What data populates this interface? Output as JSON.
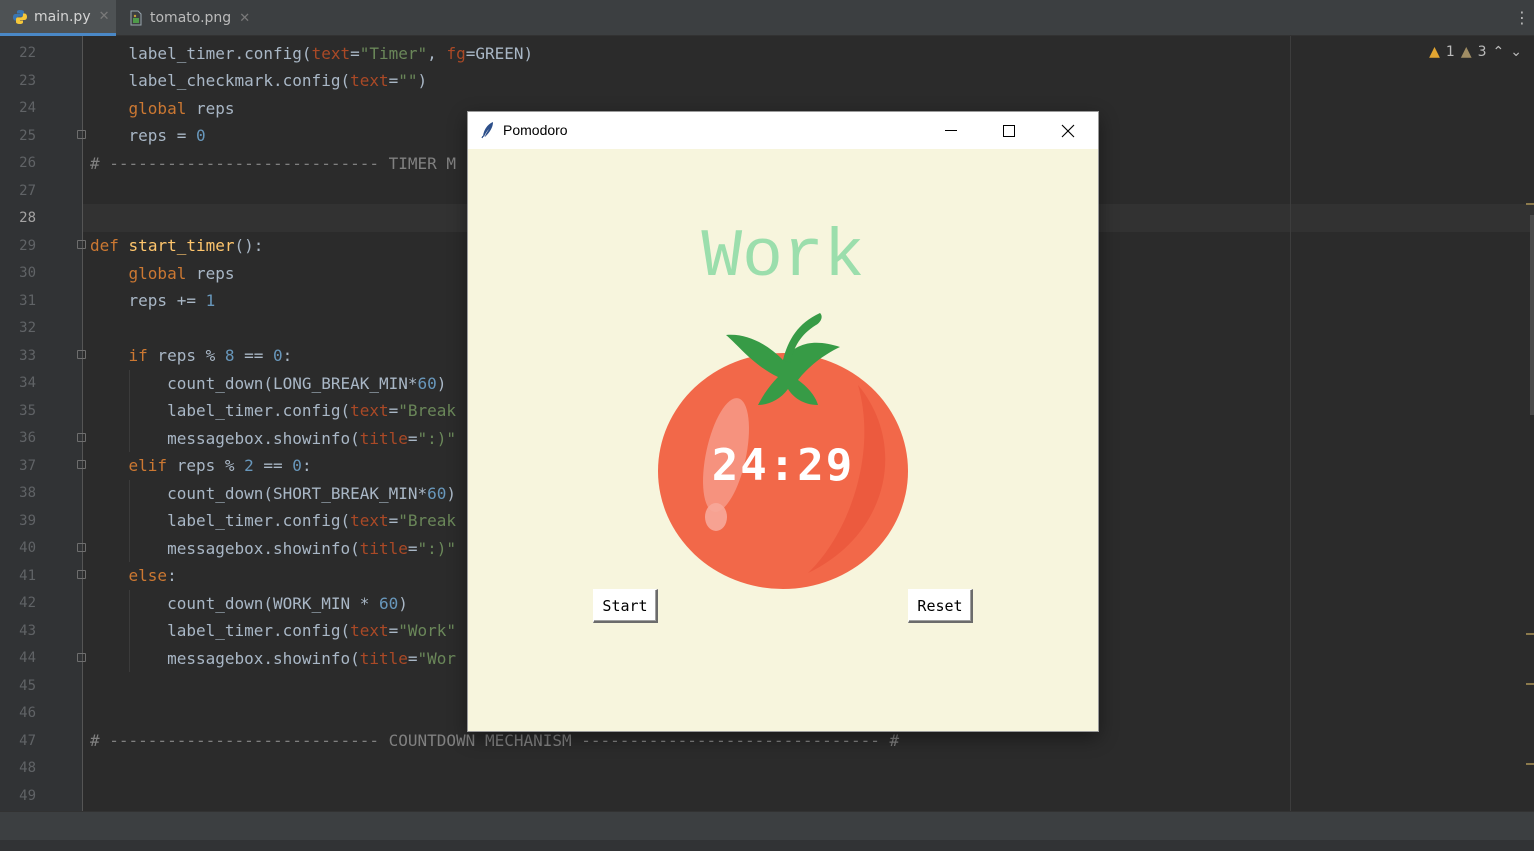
{
  "tabs": [
    {
      "label": "main.py",
      "active": true,
      "icon": "python-file-icon"
    },
    {
      "label": "tomato.png",
      "active": false,
      "icon": "image-file-icon"
    }
  ],
  "inspection": {
    "warnings": "1",
    "weak_warnings": "3"
  },
  "editor": {
    "current_line": "28",
    "lines": [
      {
        "n": "22"
      },
      {
        "n": "23"
      },
      {
        "n": "24"
      },
      {
        "n": "25"
      },
      {
        "n": "26"
      },
      {
        "n": "27"
      },
      {
        "n": "28"
      },
      {
        "n": "29"
      },
      {
        "n": "30"
      },
      {
        "n": "31"
      },
      {
        "n": "32"
      },
      {
        "n": "33"
      },
      {
        "n": "34"
      },
      {
        "n": "35"
      },
      {
        "n": "36"
      },
      {
        "n": "37"
      },
      {
        "n": "38"
      },
      {
        "n": "39"
      },
      {
        "n": "40"
      },
      {
        "n": "41"
      },
      {
        "n": "42"
      },
      {
        "n": "43"
      },
      {
        "n": "44"
      },
      {
        "n": "45"
      },
      {
        "n": "46"
      },
      {
        "n": "47"
      },
      {
        "n": "48"
      },
      {
        "n": "49"
      }
    ],
    "code": {
      "l22": "    label_timer.config(text=\"Timer\", fg=GREEN)",
      "l23": "    label_checkmark.config(text=\"\")",
      "l24": "    global reps",
      "l25": "    reps = 0",
      "l26": "# ---------------------------- TIMER M",
      "l29": "def start_timer():",
      "l30": "    global reps",
      "l31": "    reps += 1",
      "l33": "    if reps % 8 == 0:",
      "l34": "        count_down(LONG_BREAK_MIN*60)",
      "l35": "        label_timer.config(text=\"Break",
      "l36": "        messagebox.showinfo(title=\":)\"",
      "l37": "    elif reps % 2 == 0:",
      "l38": "        count_down(SHORT_BREAK_MIN*60)",
      "l39": "        label_timer.config(text=\"Break",
      "l40": "        messagebox.showinfo(title=\":)\"",
      "l41": "    else:",
      "l42": "        count_down(WORK_MIN * 60)",
      "l43": "        label_timer.config(text=\"Work\"",
      "l44": "        messagebox.showinfo(title=\"Wor",
      "l47": "# ---------------------------- COUNTDOWN MECHANISM ------------------------------- #"
    }
  },
  "pomodoro": {
    "title": "Pomodoro",
    "label": "Work",
    "timer": "24:29",
    "start_label": "Start",
    "reset_label": "Reset",
    "colors": {
      "background": "#f7f5dd",
      "label": "#9bdeac",
      "tomato": "#f26849",
      "leaf": "#379b46"
    }
  }
}
